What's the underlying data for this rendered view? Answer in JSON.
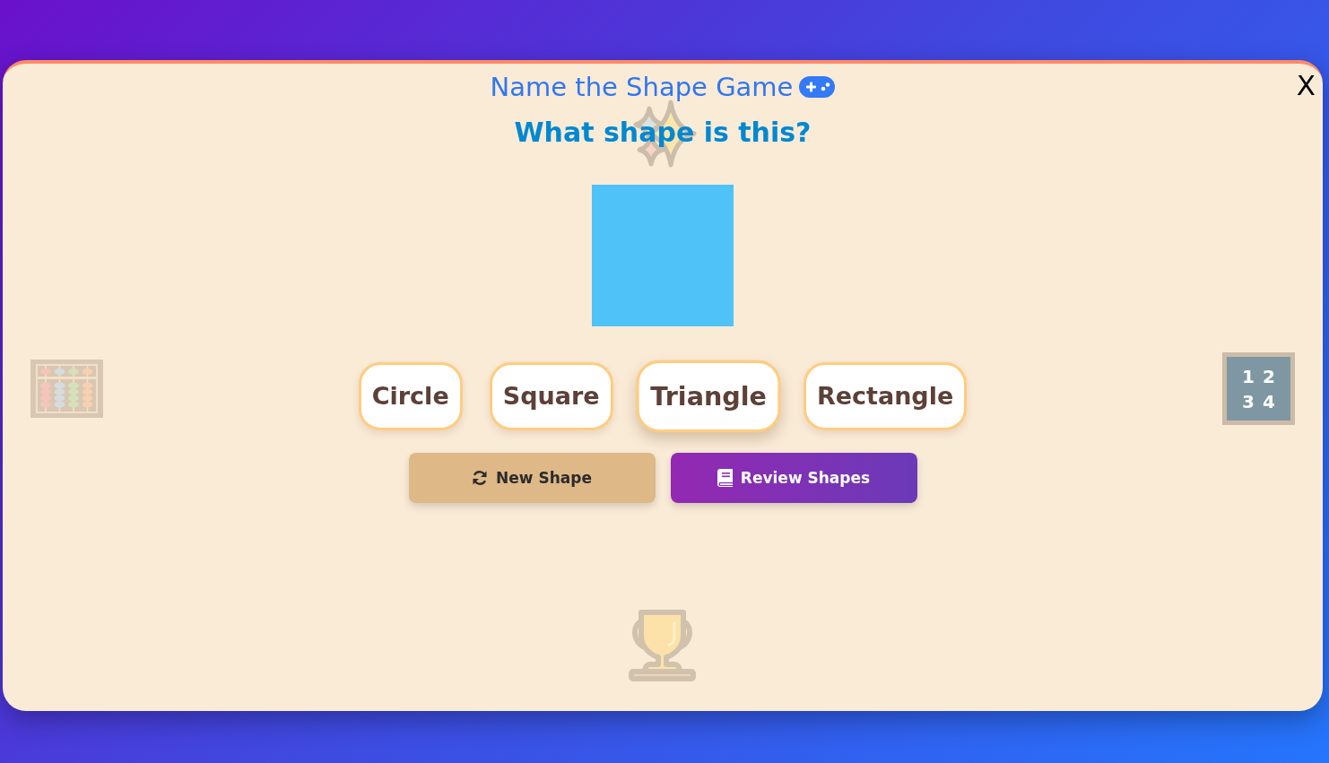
{
  "window": {
    "title": "Name the Shape Game",
    "close_label": "X"
  },
  "question": "What shape is this?",
  "shape": {
    "kind": "square"
  },
  "options": [
    {
      "label": "Circle",
      "hovered": false
    },
    {
      "label": "Square",
      "hovered": false
    },
    {
      "label": "Triangle",
      "hovered": true
    },
    {
      "label": "Rectangle",
      "hovered": false
    }
  ],
  "actions": [
    {
      "kind": "new",
      "label": "New Shape"
    },
    {
      "kind": "review",
      "label": "Review Shapes"
    }
  ],
  "number_tile": {
    "text": "1 2 3 4"
  }
}
